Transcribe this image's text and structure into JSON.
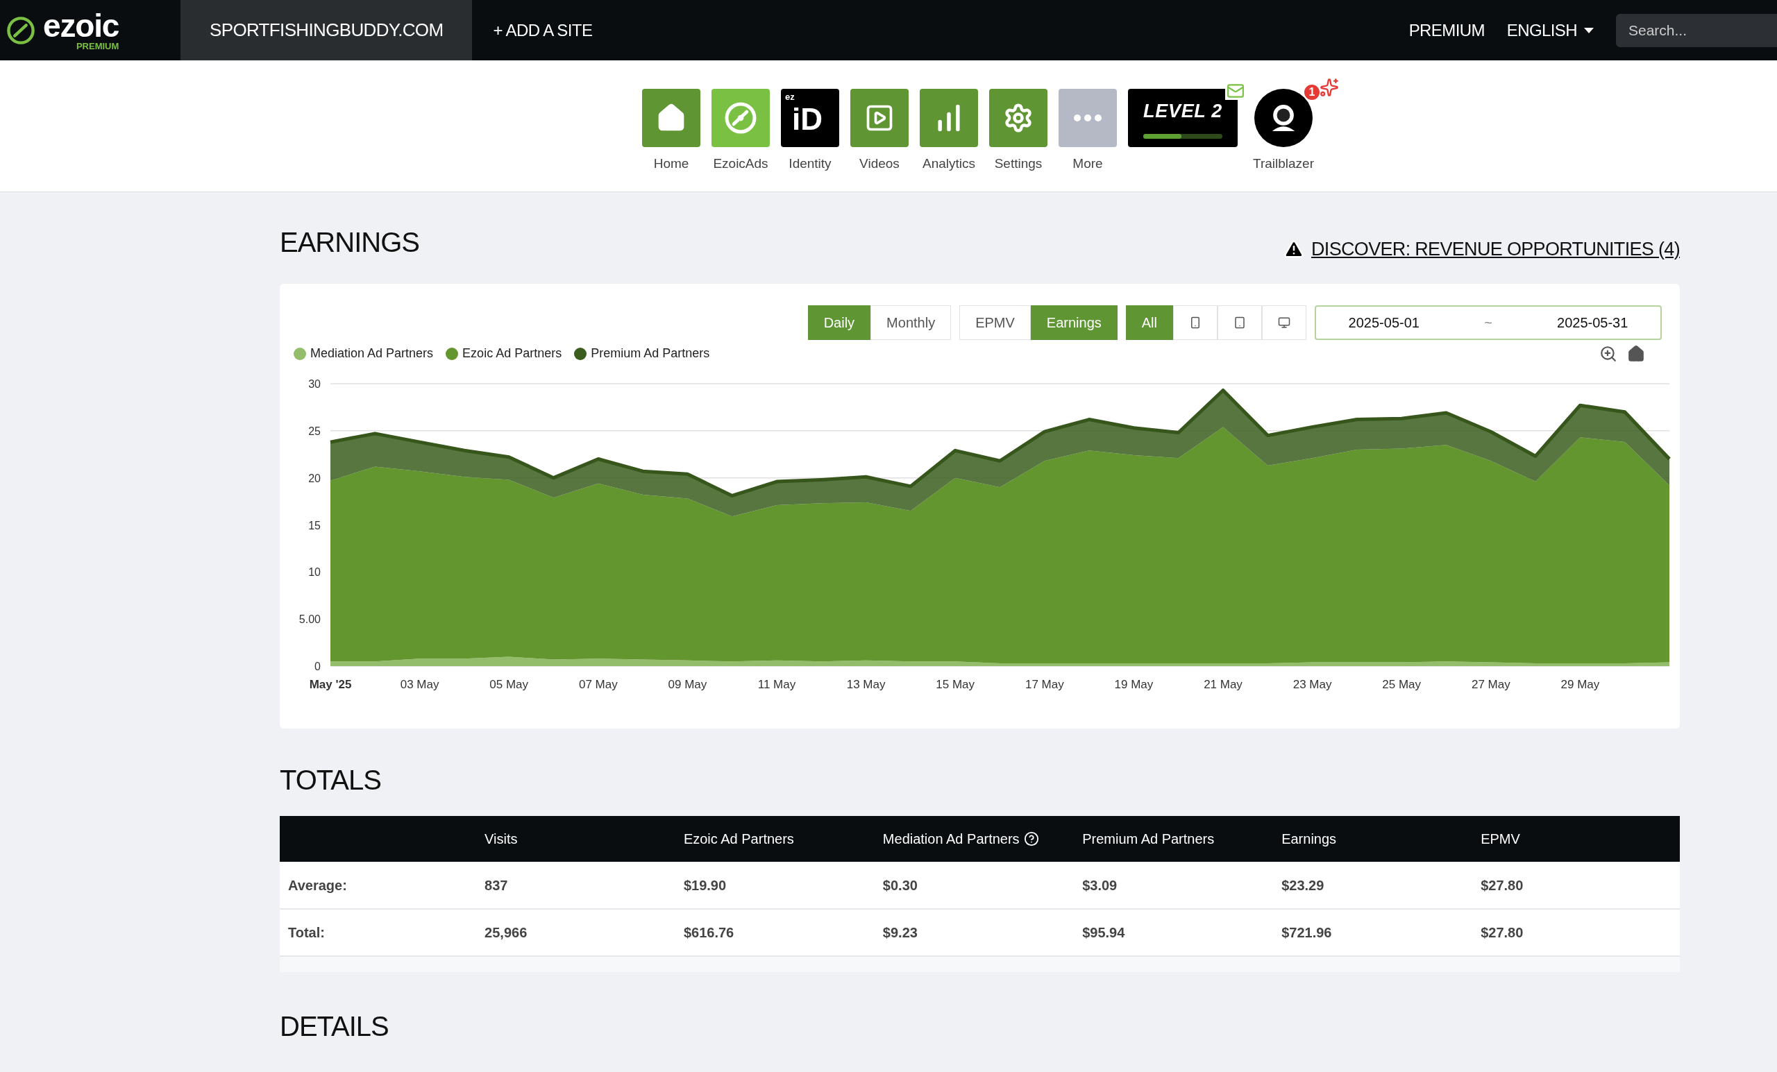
{
  "topbar": {
    "logo": "ezoic",
    "logo_badge": "PREMIUM",
    "site": "SPORTFISHINGBUDDY.COM",
    "add_site": "+ ADD A SITE",
    "premium": "PREMIUM",
    "language": "ENGLISH",
    "search": {
      "placeholder": "Search..."
    }
  },
  "nav": {
    "items": [
      {
        "label": "Home"
      },
      {
        "label": "EzoicAds"
      },
      {
        "label": "Identity",
        "tile_text": "ez",
        "tile_main": "iD"
      },
      {
        "label": "Videos"
      },
      {
        "label": "Analytics"
      },
      {
        "label": "Settings"
      },
      {
        "label": "More"
      }
    ],
    "level": {
      "text": "LEVEL 2",
      "level": 0.48
    },
    "trailblazer": {
      "label": "Trailblazer",
      "badge": "1"
    }
  },
  "earnings": {
    "title": "EARNINGS",
    "discover_link": "DISCOVER: REVENUE OPPORTUNITIES (4)",
    "toggle_groups": [
      [
        {
          "kind": "text",
          "label": "Daily",
          "selected": true
        },
        {
          "kind": "text",
          "label": "Monthly",
          "selected": false
        }
      ],
      [
        {
          "kind": "text",
          "label": "EPMV",
          "selected": false
        },
        {
          "kind": "text",
          "label": "Earnings",
          "selected": true
        }
      ],
      [
        {
          "kind": "text",
          "label": "All",
          "selected": true
        },
        {
          "kind": "phone",
          "selected": false
        },
        {
          "kind": "tablet",
          "selected": false
        },
        {
          "kind": "desktop",
          "selected": false
        }
      ]
    ],
    "date_range": {
      "start": "2025-05-01",
      "separator": "~",
      "end": "2025-05-31"
    },
    "chart_data": {
      "type": "area",
      "stacked": true,
      "categories": [
        "May '25",
        null,
        "03 May",
        null,
        "05 May",
        null,
        "07 May",
        null,
        "09 May",
        null,
        "11 May",
        null,
        "13 May",
        null,
        "15 May",
        null,
        "17 May",
        null,
        "19 May",
        null,
        "21 May",
        null,
        "23 May",
        null,
        "25 May",
        null,
        "27 May",
        null,
        "29 May",
        null,
        null
      ],
      "series": [
        {
          "name": "Mediation Ad Partners",
          "color": "#93bd6b",
          "values": [
            0.5,
            0.5,
            0.8,
            0.8,
            1.0,
            0.7,
            0.8,
            0.7,
            0.6,
            0.5,
            0.6,
            0.5,
            0.6,
            0.5,
            0.5,
            0.3,
            0.3,
            0.3,
            0.3,
            0.3,
            0.3,
            0.3,
            0.4,
            0.4,
            0.4,
            0.5,
            0.4,
            0.3,
            0.3,
            0.3,
            0.4
          ]
        },
        {
          "name": "Ezoic Ad Partners",
          "color": "#64962f",
          "values": [
            19.2,
            20.7,
            19.9,
            19.3,
            18.8,
            17.2,
            18.6,
            17.5,
            17.2,
            15.4,
            16.5,
            16.8,
            16.8,
            16.0,
            19.5,
            18.7,
            21.5,
            22.6,
            22.1,
            21.8,
            25.1,
            21.0,
            21.7,
            22.6,
            22.7,
            23.0,
            21.4,
            19.3,
            24.0,
            23.5,
            18.8
          ]
        },
        {
          "name": "Premium Ad Partners",
          "color": "#3b5e1f",
          "values": [
            4.1,
            3.5,
            3.1,
            2.8,
            2.4,
            2.1,
            2.6,
            2.5,
            2.6,
            2.2,
            2.5,
            2.5,
            2.7,
            2.6,
            2.9,
            2.8,
            3.1,
            3.3,
            2.9,
            2.7,
            3.9,
            3.2,
            3.3,
            3.2,
            3.2,
            3.4,
            3.1,
            2.7,
            3.4,
            3.2,
            2.8
          ]
        }
      ],
      "ylim": [
        0,
        30
      ],
      "yticks": [
        0,
        {
          "value": 5,
          "label": "5.00"
        },
        10,
        15,
        20,
        25,
        30
      ]
    }
  },
  "totals": {
    "title": "TOTALS",
    "columns": [
      {
        "label": "Visits",
        "help": false
      },
      {
        "label": "Ezoic Ad Partners",
        "help": false
      },
      {
        "label": "Mediation Ad Partners",
        "help": true
      },
      {
        "label": "Premium Ad Partners",
        "help": false
      },
      {
        "label": "Earnings",
        "help": false
      },
      {
        "label": "EPMV",
        "help": false
      }
    ],
    "rows": [
      {
        "label": "Average:",
        "cells": [
          "837",
          "$19.90",
          "$0.30",
          "$3.09",
          "$23.29",
          "$27.80"
        ]
      },
      {
        "label": "Total:",
        "cells": [
          "25,966",
          "$616.76",
          "$9.23",
          "$95.94",
          "$721.96",
          "$27.80"
        ]
      }
    ]
  },
  "details": {
    "title": "DETAILS"
  }
}
